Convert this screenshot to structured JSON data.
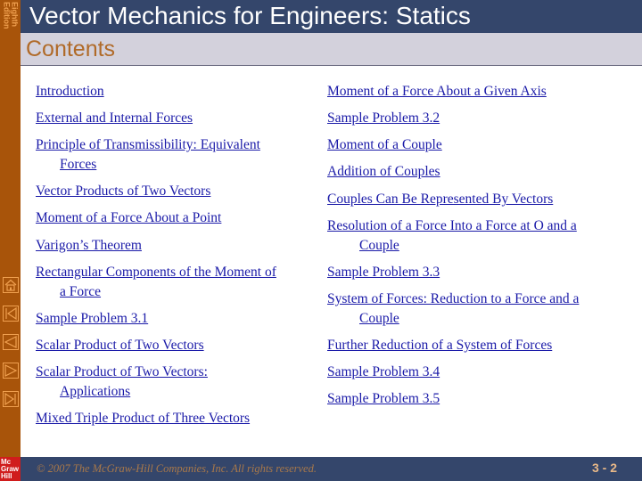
{
  "sidebar": {
    "edition_line1": "Eighth",
    "edition_line2": "Edition",
    "nav": [
      {
        "name": "home",
        "icon": "home-icon"
      },
      {
        "name": "first",
        "icon": "first-slide-icon"
      },
      {
        "name": "previous",
        "icon": "previous-slide-icon"
      },
      {
        "name": "next",
        "icon": "next-slide-icon"
      },
      {
        "name": "last",
        "icon": "last-slide-icon"
      }
    ]
  },
  "header": {
    "title": "Vector Mechanics for Engineers: Statics",
    "subtitle": "Contents"
  },
  "contents": {
    "left": [
      {
        "line1": "Introduction",
        "line2": ""
      },
      {
        "line1": "External and Internal Forces",
        "line2": ""
      },
      {
        "line1": "Principle of Transmissibility: Equivalent",
        "line2": "Forces"
      },
      {
        "line1": "Vector Products of Two Vectors",
        "line2": ""
      },
      {
        "line1": "Moment of a Force About a Point",
        "line2": ""
      },
      {
        "line1": "Varigon’s Theorem",
        "line2": ""
      },
      {
        "line1": "Rectangular Components of the Moment of",
        "line2": "a Force"
      },
      {
        "line1": "Sample Problem 3.1",
        "line2": ""
      },
      {
        "line1": "Scalar Product of Two Vectors",
        "line2": ""
      },
      {
        "line1": "Scalar Product of Two Vectors:",
        "line2": "Applications"
      },
      {
        "line1": "Mixed Triple Product of Three Vectors",
        "line2": ""
      }
    ],
    "right": [
      {
        "line1": "Moment of a Force About a Given Axis",
        "line2": ""
      },
      {
        "line1": "Sample Problem 3.2",
        "line2": ""
      },
      {
        "line1": "Moment of a Couple",
        "line2": ""
      },
      {
        "line1": "Addition of Couples",
        "line2": ""
      },
      {
        "line1": "Couples Can Be Represented By Vectors",
        "line2": ""
      },
      {
        "line1": "Resolution of a Force Into a Force at O and a",
        "line2": "Couple"
      },
      {
        "line1": "Sample Problem 3.3",
        "line2": ""
      },
      {
        "line1": "System of Forces:  Reduction to a Force and a",
        "line2": "Couple"
      },
      {
        "line1": "Further Reduction of a System of Forces",
        "line2": ""
      },
      {
        "line1": "Sample Problem 3.4",
        "line2": ""
      },
      {
        "line1": "Sample Problem 3.5",
        "line2": ""
      }
    ]
  },
  "footer": {
    "logo_line1": "Mc",
    "logo_line2": "Graw",
    "logo_line3": "Hill",
    "copyright": "© 2007 The McGraw-Hill Companies, Inc. All rights reserved.",
    "page_number": "3 - 2"
  }
}
